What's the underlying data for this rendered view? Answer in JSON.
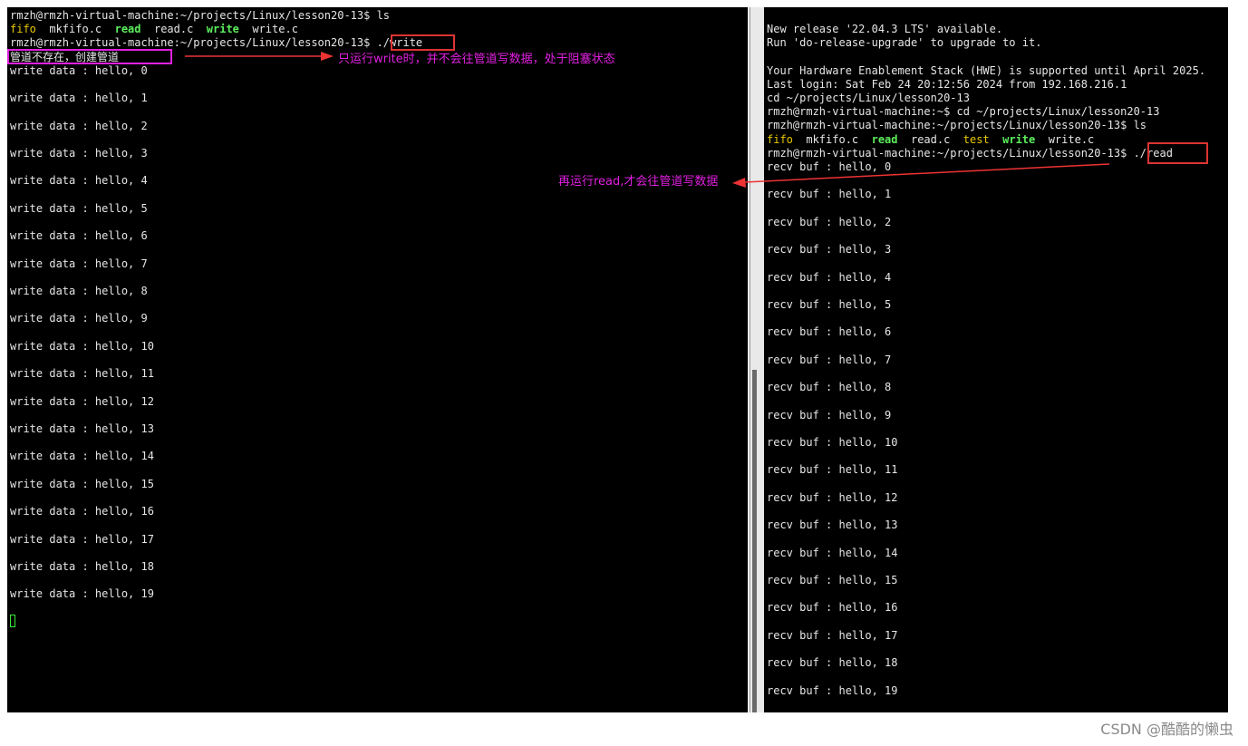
{
  "left_terminal": {
    "lines": [
      {
        "segments": [
          {
            "text": "rmzh@rmzh-virtual-machine:~/projects/Linux/lesson20-13$ ls",
            "cls": "wht"
          }
        ]
      },
      {
        "segments": [
          {
            "text": "fifo",
            "cls": "yel"
          },
          {
            "text": "  mkfifo.c  ",
            "cls": "wht"
          },
          {
            "text": "read",
            "cls": "grn"
          },
          {
            "text": "  read.c  ",
            "cls": "wht"
          },
          {
            "text": "write",
            "cls": "grn"
          },
          {
            "text": "  write.c",
            "cls": "wht"
          }
        ]
      },
      {
        "segments": [
          {
            "text": "rmzh@rmzh-virtual-machine:~/projects/Linux/lesson20-13$ ./write",
            "cls": "wht"
          }
        ]
      },
      {
        "segments": [
          {
            "text": "管道不存在，创建管道",
            "cls": "wht cjk"
          }
        ]
      },
      {
        "segments": [
          {
            "text": "write data : hello, 0",
            "cls": "wht"
          }
        ]
      },
      {
        "segments": [
          {
            "text": "",
            "cls": "wht"
          }
        ]
      },
      {
        "segments": [
          {
            "text": "write data : hello, 1",
            "cls": "wht"
          }
        ]
      },
      {
        "segments": [
          {
            "text": "",
            "cls": "wht"
          }
        ]
      },
      {
        "segments": [
          {
            "text": "write data : hello, 2",
            "cls": "wht"
          }
        ]
      },
      {
        "segments": [
          {
            "text": "",
            "cls": "wht"
          }
        ]
      },
      {
        "segments": [
          {
            "text": "write data : hello, 3",
            "cls": "wht"
          }
        ]
      },
      {
        "segments": [
          {
            "text": "",
            "cls": "wht"
          }
        ]
      },
      {
        "segments": [
          {
            "text": "write data : hello, 4",
            "cls": "wht"
          }
        ]
      },
      {
        "segments": [
          {
            "text": "",
            "cls": "wht"
          }
        ]
      },
      {
        "segments": [
          {
            "text": "write data : hello, 5",
            "cls": "wht"
          }
        ]
      },
      {
        "segments": [
          {
            "text": "",
            "cls": "wht"
          }
        ]
      },
      {
        "segments": [
          {
            "text": "write data : hello, 6",
            "cls": "wht"
          }
        ]
      },
      {
        "segments": [
          {
            "text": "",
            "cls": "wht"
          }
        ]
      },
      {
        "segments": [
          {
            "text": "write data : hello, 7",
            "cls": "wht"
          }
        ]
      },
      {
        "segments": [
          {
            "text": "",
            "cls": "wht"
          }
        ]
      },
      {
        "segments": [
          {
            "text": "write data : hello, 8",
            "cls": "wht"
          }
        ]
      },
      {
        "segments": [
          {
            "text": "",
            "cls": "wht"
          }
        ]
      },
      {
        "segments": [
          {
            "text": "write data : hello, 9",
            "cls": "wht"
          }
        ]
      },
      {
        "segments": [
          {
            "text": "",
            "cls": "wht"
          }
        ]
      },
      {
        "segments": [
          {
            "text": "write data : hello, 10",
            "cls": "wht"
          }
        ]
      },
      {
        "segments": [
          {
            "text": "",
            "cls": "wht"
          }
        ]
      },
      {
        "segments": [
          {
            "text": "write data : hello, 11",
            "cls": "wht"
          }
        ]
      },
      {
        "segments": [
          {
            "text": "",
            "cls": "wht"
          }
        ]
      },
      {
        "segments": [
          {
            "text": "write data : hello, 12",
            "cls": "wht"
          }
        ]
      },
      {
        "segments": [
          {
            "text": "",
            "cls": "wht"
          }
        ]
      },
      {
        "segments": [
          {
            "text": "write data : hello, 13",
            "cls": "wht"
          }
        ]
      },
      {
        "segments": [
          {
            "text": "",
            "cls": "wht"
          }
        ]
      },
      {
        "segments": [
          {
            "text": "write data : hello, 14",
            "cls": "wht"
          }
        ]
      },
      {
        "segments": [
          {
            "text": "",
            "cls": "wht"
          }
        ]
      },
      {
        "segments": [
          {
            "text": "write data : hello, 15",
            "cls": "wht"
          }
        ]
      },
      {
        "segments": [
          {
            "text": "",
            "cls": "wht"
          }
        ]
      },
      {
        "segments": [
          {
            "text": "write data : hello, 16",
            "cls": "wht"
          }
        ]
      },
      {
        "segments": [
          {
            "text": "",
            "cls": "wht"
          }
        ]
      },
      {
        "segments": [
          {
            "text": "write data : hello, 17",
            "cls": "wht"
          }
        ]
      },
      {
        "segments": [
          {
            "text": "",
            "cls": "wht"
          }
        ]
      },
      {
        "segments": [
          {
            "text": "write data : hello, 18",
            "cls": "wht"
          }
        ]
      },
      {
        "segments": [
          {
            "text": "",
            "cls": "wht"
          }
        ]
      },
      {
        "segments": [
          {
            "text": "write data : hello, 19",
            "cls": "wht"
          }
        ]
      }
    ]
  },
  "right_terminal": {
    "lines": [
      {
        "segments": [
          {
            "text": "New release '22.04.3 LTS' available.",
            "cls": "wht"
          }
        ]
      },
      {
        "segments": [
          {
            "text": "Run 'do-release-upgrade' to upgrade to it.",
            "cls": "wht"
          }
        ]
      },
      {
        "segments": [
          {
            "text": "",
            "cls": "wht"
          }
        ]
      },
      {
        "segments": [
          {
            "text": "Your Hardware Enablement Stack (HWE) is supported until April 2025.",
            "cls": "wht"
          }
        ]
      },
      {
        "segments": [
          {
            "text": "Last login: Sat Feb 24 20:12:56 2024 from 192.168.216.1",
            "cls": "wht"
          }
        ]
      },
      {
        "segments": [
          {
            "text": "cd ~/projects/Linux/lesson20-13",
            "cls": "wht"
          }
        ]
      },
      {
        "segments": [
          {
            "text": "rmzh@rmzh-virtual-machine:~$ cd ~/projects/Linux/lesson20-13",
            "cls": "wht"
          }
        ]
      },
      {
        "segments": [
          {
            "text": "rmzh@rmzh-virtual-machine:~/projects/Linux/lesson20-13$ ls",
            "cls": "wht"
          }
        ]
      },
      {
        "segments": [
          {
            "text": "fifo",
            "cls": "yel"
          },
          {
            "text": "  mkfifo.c  ",
            "cls": "wht"
          },
          {
            "text": "read",
            "cls": "grn"
          },
          {
            "text": "  read.c  ",
            "cls": "wht"
          },
          {
            "text": "test",
            "cls": "yel"
          },
          {
            "text": "  ",
            "cls": "wht"
          },
          {
            "text": "write",
            "cls": "grn"
          },
          {
            "text": "  write.c",
            "cls": "wht"
          }
        ]
      },
      {
        "segments": [
          {
            "text": "rmzh@rmzh-virtual-machine:~/projects/Linux/lesson20-13$ ./read",
            "cls": "wht"
          }
        ]
      },
      {
        "segments": [
          {
            "text": "recv buf : hello, 0",
            "cls": "wht"
          }
        ]
      },
      {
        "segments": [
          {
            "text": "",
            "cls": "wht"
          }
        ]
      },
      {
        "segments": [
          {
            "text": "recv buf : hello, 1",
            "cls": "wht"
          }
        ]
      },
      {
        "segments": [
          {
            "text": "",
            "cls": "wht"
          }
        ]
      },
      {
        "segments": [
          {
            "text": "recv buf : hello, 2",
            "cls": "wht"
          }
        ]
      },
      {
        "segments": [
          {
            "text": "",
            "cls": "wht"
          }
        ]
      },
      {
        "segments": [
          {
            "text": "recv buf : hello, 3",
            "cls": "wht"
          }
        ]
      },
      {
        "segments": [
          {
            "text": "",
            "cls": "wht"
          }
        ]
      },
      {
        "segments": [
          {
            "text": "recv buf : hello, 4",
            "cls": "wht"
          }
        ]
      },
      {
        "segments": [
          {
            "text": "",
            "cls": "wht"
          }
        ]
      },
      {
        "segments": [
          {
            "text": "recv buf : hello, 5",
            "cls": "wht"
          }
        ]
      },
      {
        "segments": [
          {
            "text": "",
            "cls": "wht"
          }
        ]
      },
      {
        "segments": [
          {
            "text": "recv buf : hello, 6",
            "cls": "wht"
          }
        ]
      },
      {
        "segments": [
          {
            "text": "",
            "cls": "wht"
          }
        ]
      },
      {
        "segments": [
          {
            "text": "recv buf : hello, 7",
            "cls": "wht"
          }
        ]
      },
      {
        "segments": [
          {
            "text": "",
            "cls": "wht"
          }
        ]
      },
      {
        "segments": [
          {
            "text": "recv buf : hello, 8",
            "cls": "wht"
          }
        ]
      },
      {
        "segments": [
          {
            "text": "",
            "cls": "wht"
          }
        ]
      },
      {
        "segments": [
          {
            "text": "recv buf : hello, 9",
            "cls": "wht"
          }
        ]
      },
      {
        "segments": [
          {
            "text": "",
            "cls": "wht"
          }
        ]
      },
      {
        "segments": [
          {
            "text": "recv buf : hello, 10",
            "cls": "wht"
          }
        ]
      },
      {
        "segments": [
          {
            "text": "",
            "cls": "wht"
          }
        ]
      },
      {
        "segments": [
          {
            "text": "recv buf : hello, 11",
            "cls": "wht"
          }
        ]
      },
      {
        "segments": [
          {
            "text": "",
            "cls": "wht"
          }
        ]
      },
      {
        "segments": [
          {
            "text": "recv buf : hello, 12",
            "cls": "wht"
          }
        ]
      },
      {
        "segments": [
          {
            "text": "",
            "cls": "wht"
          }
        ]
      },
      {
        "segments": [
          {
            "text": "recv buf : hello, 13",
            "cls": "wht"
          }
        ]
      },
      {
        "segments": [
          {
            "text": "",
            "cls": "wht"
          }
        ]
      },
      {
        "segments": [
          {
            "text": "recv buf : hello, 14",
            "cls": "wht"
          }
        ]
      },
      {
        "segments": [
          {
            "text": "",
            "cls": "wht"
          }
        ]
      },
      {
        "segments": [
          {
            "text": "recv buf : hello, 15",
            "cls": "wht"
          }
        ]
      },
      {
        "segments": [
          {
            "text": "",
            "cls": "wht"
          }
        ]
      },
      {
        "segments": [
          {
            "text": "recv buf : hello, 16",
            "cls": "wht"
          }
        ]
      },
      {
        "segments": [
          {
            "text": "",
            "cls": "wht"
          }
        ]
      },
      {
        "segments": [
          {
            "text": "recv buf : hello, 17",
            "cls": "wht"
          }
        ]
      },
      {
        "segments": [
          {
            "text": "",
            "cls": "wht"
          }
        ]
      },
      {
        "segments": [
          {
            "text": "recv buf : hello, 18",
            "cls": "wht"
          }
        ]
      },
      {
        "segments": [
          {
            "text": "",
            "cls": "wht"
          }
        ]
      },
      {
        "segments": [
          {
            "text": "recv buf : hello, 19",
            "cls": "wht"
          }
        ]
      }
    ]
  },
  "annotations": {
    "write_note": "只运行write时，并不会往管道写数据，处于阻塞状态",
    "read_note": "再运行read,才会往管道写数据",
    "note_color": "#e020e0",
    "arrow_color": "#ee3333",
    "magenta_box_color": "#e020e0",
    "red_box_color": "#dd3333"
  },
  "watermark": "CSDN @酷酷的懒虫",
  "colors": {
    "terminal_bg": "#000000",
    "text": "#e6e6e6",
    "file_yellow": "#e8c900",
    "exec_green": "#5cf05c",
    "cursor_green": "#39e639"
  }
}
